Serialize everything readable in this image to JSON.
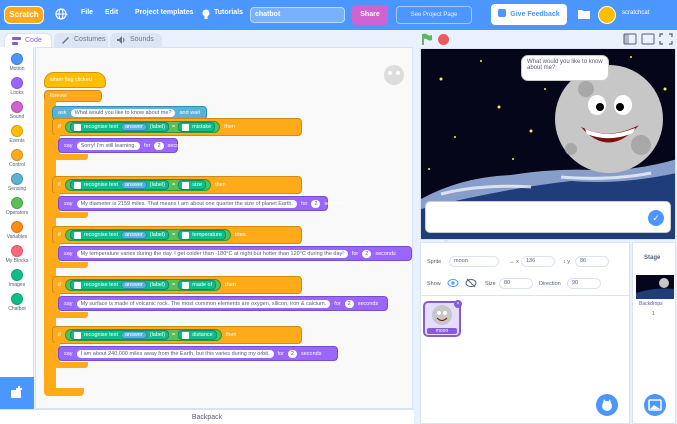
{
  "menu": {
    "logo": "Scratch",
    "file": "File",
    "edit": "Edit",
    "templates": "Project templates",
    "tutorials": "Tutorials",
    "project_title": "chatbot",
    "share": "Share",
    "see_project_page": "See Project Page",
    "give_feedback": "Give Feedback",
    "username": "scratchcat"
  },
  "tabs": {
    "code": "Code",
    "costumes": "Costumes",
    "sounds": "Sounds"
  },
  "categories": [
    {
      "label": "Motion",
      "color": "#4c97ff"
    },
    {
      "label": "Looks",
      "color": "#9966ff"
    },
    {
      "label": "Sound",
      "color": "#cf63cf"
    },
    {
      "label": "Events",
      "color": "#ffbf00"
    },
    {
      "label": "Control",
      "color": "#ffab19"
    },
    {
      "label": "Sensing",
      "color": "#5cb1d6"
    },
    {
      "label": "Operators",
      "color": "#59c059"
    },
    {
      "label": "Variables",
      "color": "#ff8c1a"
    },
    {
      "label": "My Blocks",
      "color": "#ff6680"
    },
    {
      "label": "Images",
      "color": "#0fbd8c"
    },
    {
      "label": "Chatbot",
      "color": "#0fbd8c"
    }
  ],
  "script": {
    "hat": "when flag clicked",
    "forever": "forever",
    "ask": "ask",
    "ask_text": "What would you like to know about me?",
    "and_wait": "and wait",
    "if": "if",
    "then": "then",
    "say": "say",
    "for": "for",
    "seconds": "seconds",
    "recognise_text": "recognise text",
    "answer": "answer",
    "label": "(label)",
    "equals": "=",
    "conditions": [
      {
        "label_value": "mistake",
        "say_text": "Sorry! I'm still learning.",
        "secs": "2"
      },
      {
        "label_value": "size",
        "say_text": "My diameter is 2159 miles. That means I am about one quarter the size of planet Earth.",
        "secs": "2"
      },
      {
        "label_value": "temperature",
        "say_text": "My temperature varies during the day. I get colder than -180°C at night but hotter than 120°C during the day!",
        "secs": "2"
      },
      {
        "label_value": "made of",
        "say_text": "My surface is made of volcanic rock. The most common elements are oxygen, silicon, iron & calcium.",
        "secs": "2"
      },
      {
        "label_value": "distance",
        "say_text": "I am about 240,000 miles away from the Earth, but this varies during my orbit.",
        "secs": "2"
      }
    ]
  },
  "backpack": "Backpack",
  "stage": {
    "speech": "What would you like to know about me?"
  },
  "sprite_info": {
    "sprite_label": "Sprite",
    "sprite_name": "moon",
    "x_label": "x",
    "x_value": "136",
    "y_label": "y",
    "y_value": "86",
    "show_label": "Show",
    "size_label": "Size",
    "size_value": "80",
    "direction_label": "Direction",
    "direction_value": "90",
    "thumb_name": "moon"
  },
  "stage_pane": {
    "title": "Stage",
    "backdrops_label": "Backdrops",
    "backdrops_count": "1"
  }
}
